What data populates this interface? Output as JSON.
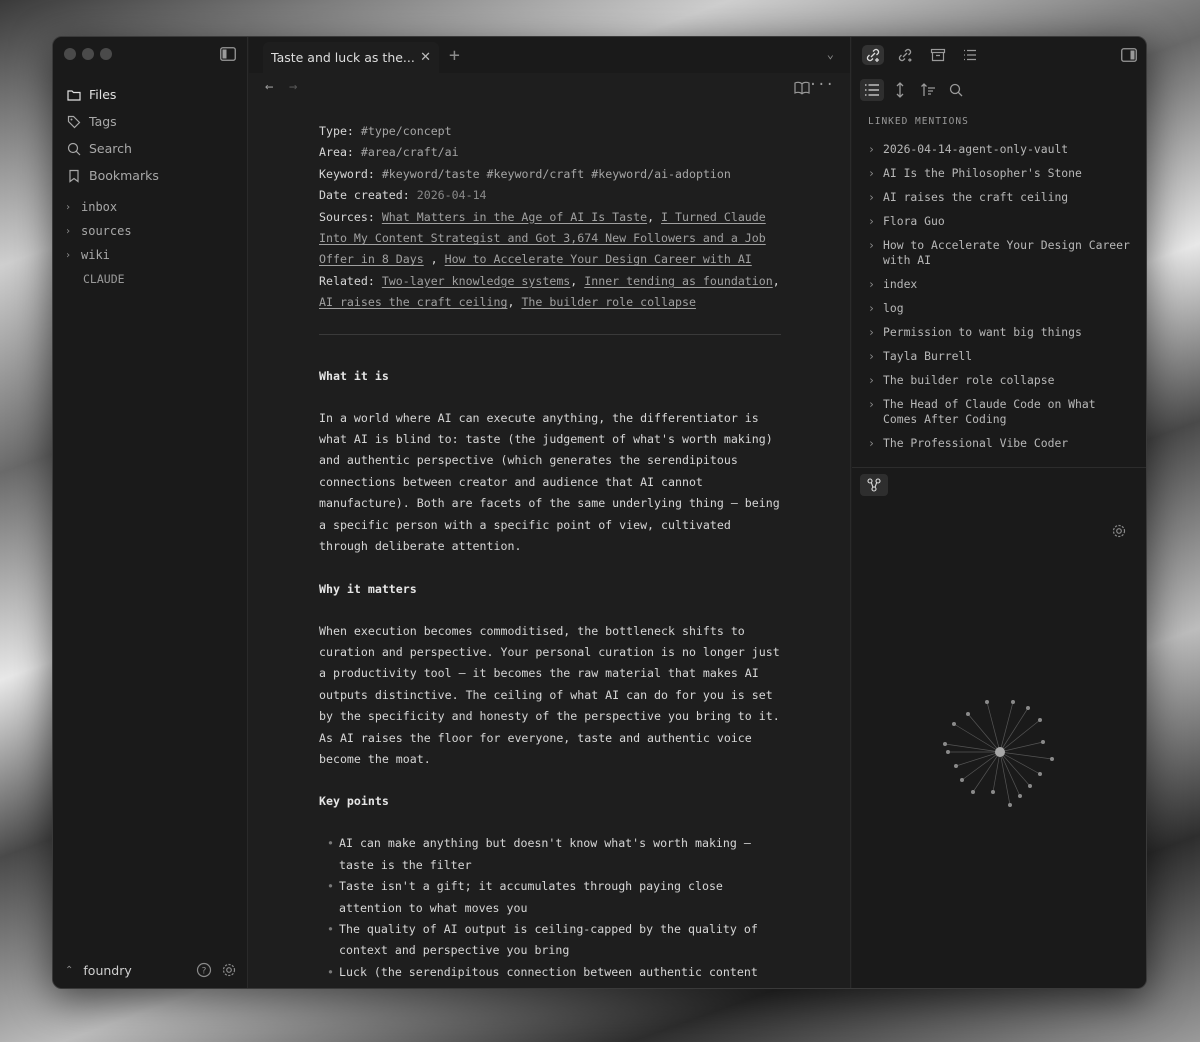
{
  "window": {
    "traffic_color": "#4a4a4a"
  },
  "sidebar": {
    "nav": [
      {
        "label": "Files",
        "icon": "folder-icon",
        "active": true
      },
      {
        "label": "Tags",
        "icon": "tag-icon"
      },
      {
        "label": "Search",
        "icon": "search-icon"
      },
      {
        "label": "Bookmarks",
        "icon": "bookmark-icon"
      }
    ],
    "tree": [
      {
        "label": "inbox",
        "type": "folder"
      },
      {
        "label": "sources",
        "type": "folder"
      },
      {
        "label": "wiki",
        "type": "folder"
      },
      {
        "label": "CLAUDE",
        "type": "file"
      }
    ],
    "vault_name": "foundry"
  },
  "tab": {
    "title": "Taste and luck as the..."
  },
  "note": {
    "props": {
      "type_key": "Type:",
      "type_val": "#type/concept",
      "area_key": "Area:",
      "area_val": "#area/craft/ai",
      "keyword_key": "Keyword:",
      "keyword_vals": [
        "#keyword/taste",
        "#keyword/craft",
        "#keyword/ai-adoption"
      ],
      "date_key": "Date created:",
      "date_val": "2026-04-14",
      "sources_key": "Sources:",
      "sources": [
        "What Matters in the Age of AI Is Taste",
        "I Turned Claude Into My Content Strategist and Got 3,674 New Followers and a Job Offer in 8 Days",
        "How to Accelerate Your Design Career with AI"
      ],
      "related_key": "Related:",
      "related": [
        "Two-layer knowledge systems",
        "Inner tending as foundation",
        "AI raises the craft ceiling",
        "The builder role collapse"
      ]
    },
    "h1": "What it is",
    "p1": "In a world where AI can execute anything, the differentiator is what AI is blind to: taste (the judgement of what's worth making) and authentic perspective (which generates the serendipitous connections between creator and audience that AI cannot manufacture). Both are facets of the same underlying thing — being a specific person with a specific point of view, cultivated through deliberate attention.",
    "h2": "Why it matters",
    "p2": "When execution becomes commoditised, the bottleneck shifts to curation and perspective. Your personal curation is no longer just a productivity tool — it becomes the raw material that makes AI outputs distinctive. The ceiling of what AI can do for you is set by the specificity and honesty of the perspective you bring to it. As AI raises the floor for everyone, taste and authentic voice become the moat.",
    "h3": "Key points",
    "points": [
      "AI can make anything but doesn't know what's worth making — taste is the filter",
      "Taste isn't a gift; it accumulates through paying close attention to what moves you",
      "The quality of AI output is ceiling-capped by the quality of context and perspective you bring",
      "Luck (the serendipitous connection between authentic content and the right reader) is exclusively generated by a specific person's genuine perspective — AI-ghostwritten content cannot create it"
    ]
  },
  "right": {
    "header": "LINKED MENTIONS",
    "mentions": [
      "2026-04-14-agent-only-vault",
      "AI Is the Philosopher's Stone",
      "AI raises the craft ceiling",
      "Flora Guo",
      "How to Accelerate Your Design Career with AI",
      "index",
      "log",
      "Permission to want big things",
      "Tayla Burrell",
      "The builder role collapse",
      "The Head of Claude Code on What Comes After Coding",
      "The Professional Vibe Coder"
    ]
  }
}
